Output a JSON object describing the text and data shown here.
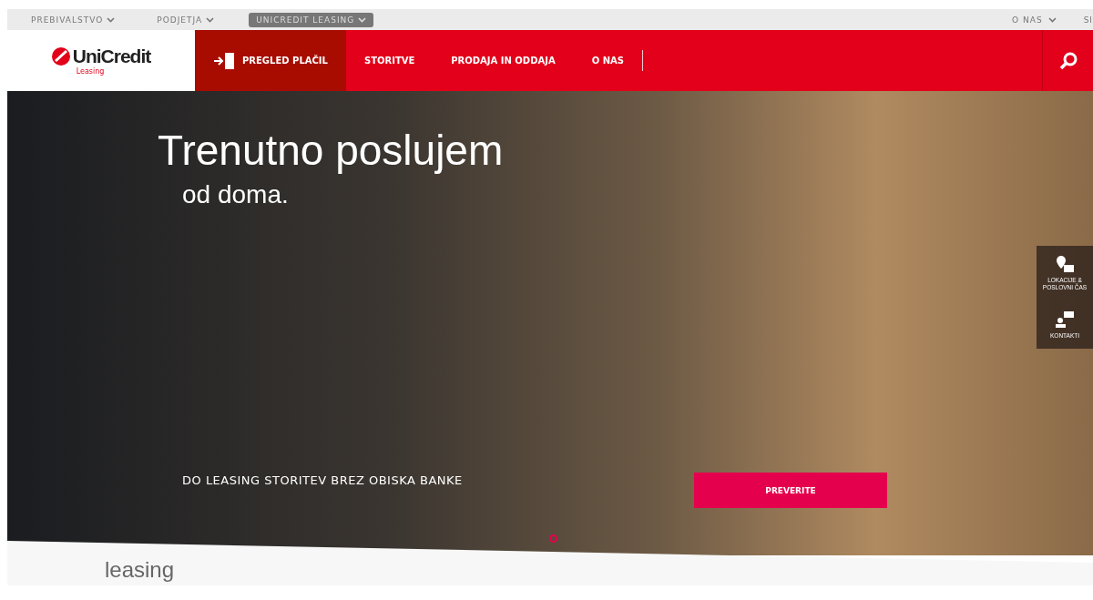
{
  "top_bar": {
    "segments": [
      {
        "label": "PREBIVALSTVO",
        "selected": false
      },
      {
        "label": "PODJETJA",
        "selected": false
      },
      {
        "label": "UNICREDIT LEASING",
        "selected": true
      }
    ],
    "right_links": [
      {
        "label": "O NAS",
        "dropdown": true
      },
      {
        "label": "SI",
        "dropdown": false
      }
    ]
  },
  "header": {
    "logo": {
      "name": "UniCredit",
      "sub": "Leasing"
    },
    "nav": [
      {
        "label": "PREGLED PLAČIL",
        "selected": true
      },
      {
        "label": "STORITVE",
        "selected": false
      },
      {
        "label": "PRODAJA IN ODDAJA",
        "selected": false
      },
      {
        "label": "O NAS",
        "selected": false
      }
    ]
  },
  "hero": {
    "title": "Trenutno poslujem",
    "subtitle": "od doma.",
    "tagline": "DO LEASING STORITEV BREZ OBISKA BANKE",
    "button": "PREVERITE"
  },
  "side_panel": [
    {
      "kind": "location",
      "lines": [
        "LOKACIJE &",
        "POSLOVNI ČAS"
      ]
    },
    {
      "kind": "contact",
      "lines": [
        "KONTAKTI"
      ]
    }
  ],
  "section": {
    "heading": "leasing"
  }
}
